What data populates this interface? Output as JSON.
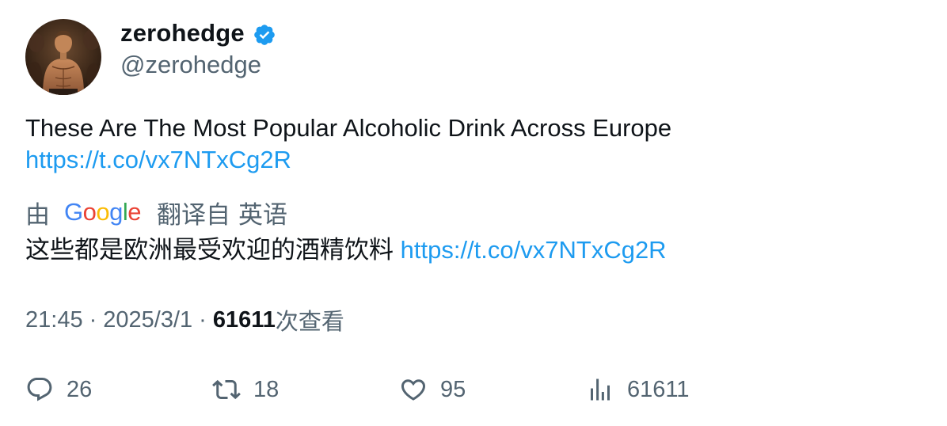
{
  "author": {
    "display_name": "zerohedge",
    "handle": "@zerohedge",
    "verified": true,
    "verified_color": "#1d9bf0"
  },
  "tweet": {
    "text": "These Are The Most Popular Alcoholic Drink Across Europe",
    "link": "https://t.co/vx7NTxCg2R"
  },
  "translation": {
    "by_label": "由",
    "provider": "Google",
    "from_label": "翻译自",
    "source_language": "英语",
    "text": "这些都是欧洲最受欢迎的酒精饮料",
    "link": "https://t.co/vx7NTxCg2R"
  },
  "meta": {
    "time": "21:45",
    "separator": "·",
    "date": "2025/3/1",
    "views_count": "61611",
    "views_label": "次查看"
  },
  "actions": {
    "replies": "26",
    "retweets": "18",
    "likes": "95",
    "views": "61611"
  },
  "colors": {
    "text_primary": "#0f1419",
    "text_secondary": "#536471",
    "link": "#1d9bf0"
  },
  "icons": {
    "reply": "reply-icon",
    "retweet": "retweet-icon",
    "like": "heart-icon",
    "views": "bar-chart-icon",
    "verified": "verified-badge-icon"
  }
}
